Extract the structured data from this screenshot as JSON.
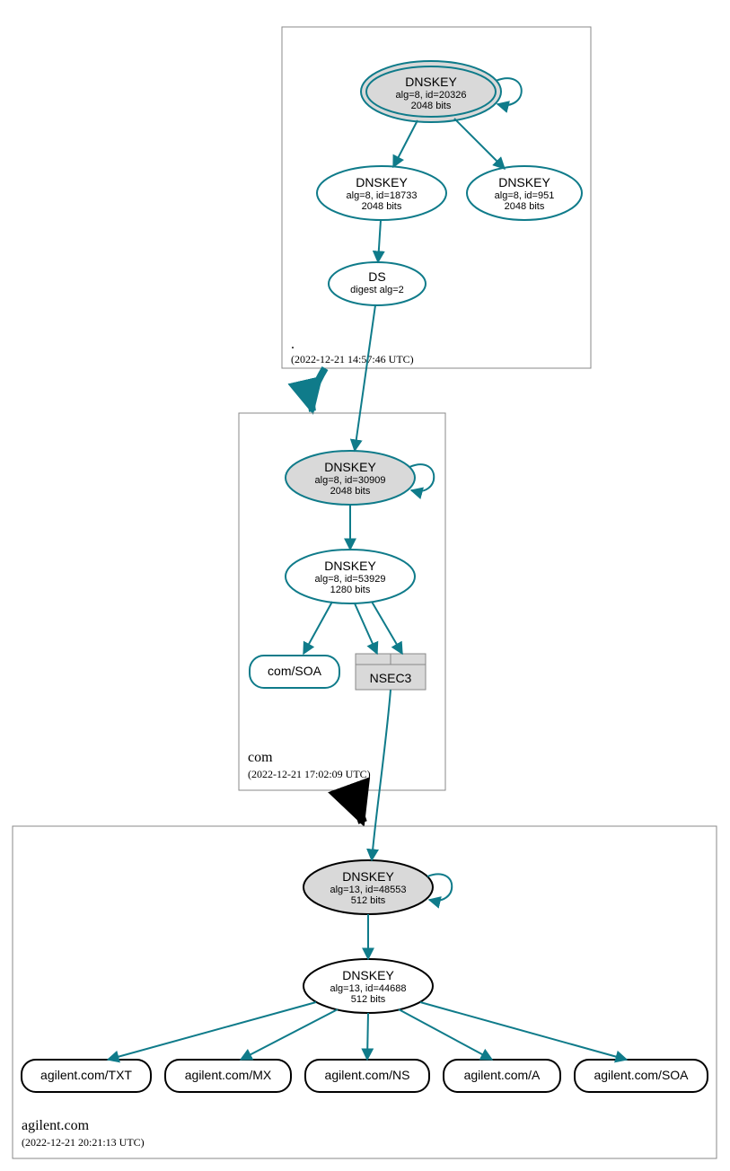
{
  "colors": {
    "teal": "#0f7b8a",
    "gray_fill": "#d9d9d9",
    "black": "#000000",
    "white": "#ffffff"
  },
  "zones": {
    "root": {
      "name": ".",
      "timestamp": "(2022-12-21 14:57:46 UTC)"
    },
    "com": {
      "name": "com",
      "timestamp": "(2022-12-21 17:02:09 UTC)"
    },
    "agilent": {
      "name": "agilent.com",
      "timestamp": "(2022-12-21 20:21:13 UTC)"
    }
  },
  "nodes": {
    "root_ksk": {
      "title": "DNSKEY",
      "line1": "alg=8, id=20326",
      "line2": "2048 bits"
    },
    "root_zsk1": {
      "title": "DNSKEY",
      "line1": "alg=8, id=18733",
      "line2": "2048 bits"
    },
    "root_zsk2": {
      "title": "DNSKEY",
      "line1": "alg=8, id=951",
      "line2": "2048 bits"
    },
    "root_ds": {
      "title": "DS",
      "line1": "digest alg=2"
    },
    "com_ksk": {
      "title": "DNSKEY",
      "line1": "alg=8, id=30909",
      "line2": "2048 bits"
    },
    "com_zsk": {
      "title": "DNSKEY",
      "line1": "alg=8, id=53929",
      "line2": "1280 bits"
    },
    "com_soa": {
      "title": "com/SOA"
    },
    "com_nsec3": {
      "title": "NSEC3"
    },
    "ag_ksk": {
      "title": "DNSKEY",
      "line1": "alg=13, id=48553",
      "line2": "512 bits"
    },
    "ag_zsk": {
      "title": "DNSKEY",
      "line1": "alg=13, id=44688",
      "line2": "512 bits"
    },
    "ag_txt": {
      "title": "agilent.com/TXT"
    },
    "ag_mx": {
      "title": "agilent.com/MX"
    },
    "ag_ns": {
      "title": "agilent.com/NS"
    },
    "ag_a": {
      "title": "agilent.com/A"
    },
    "ag_soa": {
      "title": "agilent.com/SOA"
    }
  }
}
